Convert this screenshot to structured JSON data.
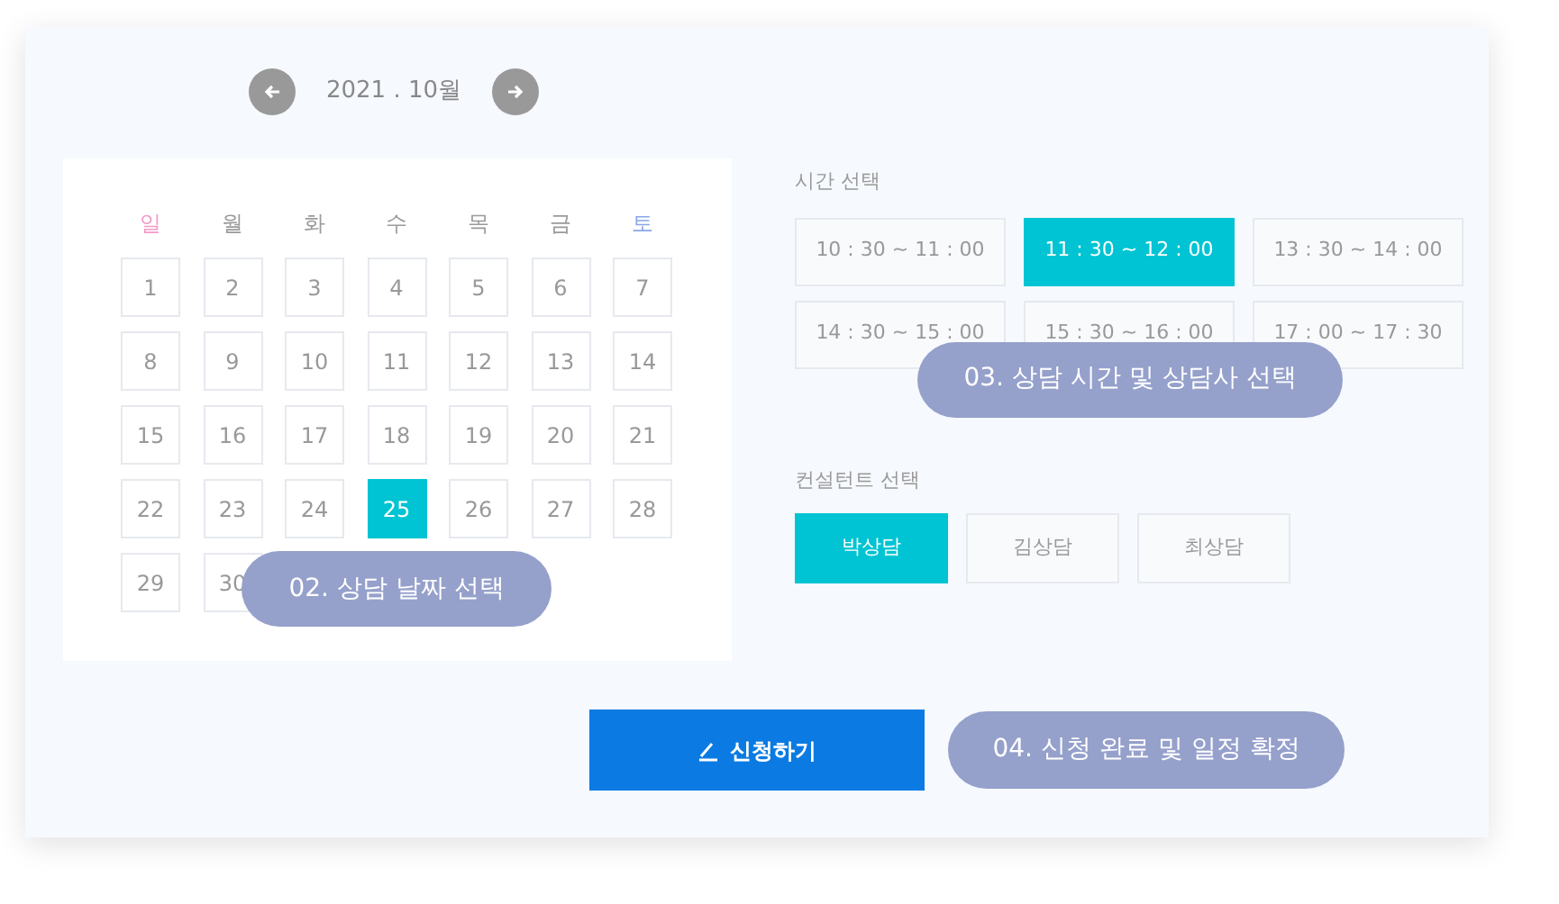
{
  "month_nav": {
    "label": "2021 . 10월"
  },
  "calendar": {
    "weekdays": [
      {
        "label": "일",
        "color": "#f49ac8"
      },
      {
        "label": "월",
        "color": "#9a9a9a"
      },
      {
        "label": "화",
        "color": "#9a9a9a"
      },
      {
        "label": "수",
        "color": "#9a9a9a"
      },
      {
        "label": "목",
        "color": "#9a9a9a"
      },
      {
        "label": "금",
        "color": "#9a9a9a"
      },
      {
        "label": "토",
        "color": "#8aa8e6"
      }
    ],
    "days": [
      {
        "label": "1",
        "selected": false
      },
      {
        "label": "2",
        "selected": false
      },
      {
        "label": "3",
        "selected": false
      },
      {
        "label": "4",
        "selected": false
      },
      {
        "label": "5",
        "selected": false
      },
      {
        "label": "6",
        "selected": false
      },
      {
        "label": "7",
        "selected": false
      },
      {
        "label": "8",
        "selected": false
      },
      {
        "label": "9",
        "selected": false
      },
      {
        "label": "10",
        "selected": false
      },
      {
        "label": "11",
        "selected": false
      },
      {
        "label": "12",
        "selected": false
      },
      {
        "label": "13",
        "selected": false
      },
      {
        "label": "14",
        "selected": false
      },
      {
        "label": "15",
        "selected": false
      },
      {
        "label": "16",
        "selected": false
      },
      {
        "label": "17",
        "selected": false
      },
      {
        "label": "18",
        "selected": false
      },
      {
        "label": "19",
        "selected": false
      },
      {
        "label": "20",
        "selected": false
      },
      {
        "label": "21",
        "selected": false
      },
      {
        "label": "22",
        "selected": false
      },
      {
        "label": "23",
        "selected": false
      },
      {
        "label": "24",
        "selected": false
      },
      {
        "label": "25",
        "selected": true
      },
      {
        "label": "26",
        "selected": false
      },
      {
        "label": "27",
        "selected": false
      },
      {
        "label": "28",
        "selected": false
      },
      {
        "label": "29",
        "selected": false
      },
      {
        "label": "30",
        "selected": false
      }
    ],
    "callout": "02. 상담 날짜 선택"
  },
  "time_section": {
    "label": "시간 선택",
    "slots": [
      {
        "label": "10 : 30 ~ 11 : 00",
        "selected": false
      },
      {
        "label": "11 : 30 ~ 12 : 00",
        "selected": true
      },
      {
        "label": "13 : 30 ~ 14 : 00",
        "selected": false
      },
      {
        "label": "14 : 30 ~ 15 : 00",
        "selected": false
      },
      {
        "label": "15 : 30 ~ 16 : 00",
        "selected": false
      },
      {
        "label": "17 : 00 ~ 17 : 30",
        "selected": false
      }
    ],
    "callout": "03. 상담 시간 및 상담사 선택"
  },
  "consultant_section": {
    "label": "컨설턴트 선택",
    "options": [
      {
        "label": "박상담",
        "selected": true
      },
      {
        "label": "김상담",
        "selected": false
      },
      {
        "label": "최상담",
        "selected": false
      }
    ]
  },
  "submit_button": "신청하기",
  "final_callout": "04. 신청 완료 및 일정 확정"
}
